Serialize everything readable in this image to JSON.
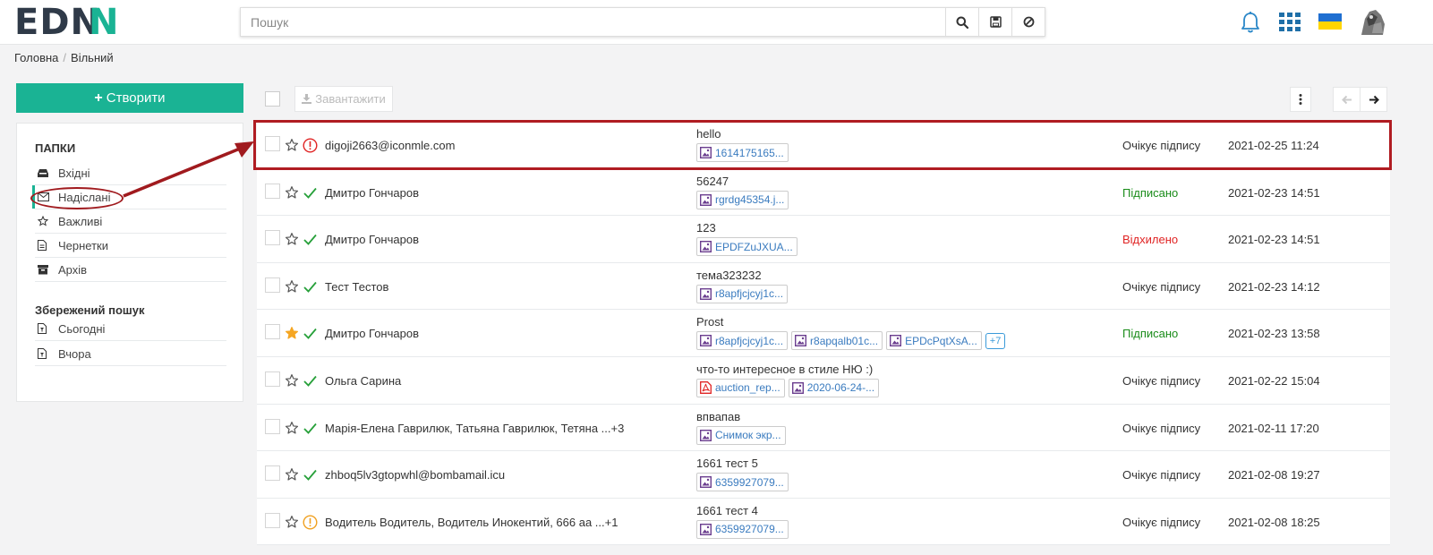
{
  "header": {
    "logo": {
      "ed": "ED",
      "n1": "N",
      "n2": "N",
      "i": "I"
    },
    "search_placeholder": "Пошук"
  },
  "breadcrumb": {
    "home": "Головна",
    "current": "Вільний"
  },
  "sidebar": {
    "create_label": "Створити",
    "folders_heading": "ПАПКИ",
    "folders": [
      {
        "label": "Вхідні",
        "icon": "inbox-icon"
      },
      {
        "label": "Надіслані",
        "icon": "envelope-icon"
      },
      {
        "label": "Важливі",
        "icon": "star-icon"
      },
      {
        "label": "Чернетки",
        "icon": "file-icon"
      },
      {
        "label": "Архів",
        "icon": "archive-icon"
      }
    ],
    "saved_heading": "Збережений пошук",
    "saved": [
      {
        "label": "Сьогодні",
        "icon": "file-filter-icon"
      },
      {
        "label": "Вчора",
        "icon": "file-filter-icon"
      }
    ]
  },
  "toolbar": {
    "download_label": "Завантажити"
  },
  "colors": {
    "accent": "#1ab394",
    "signed": "#1a8c1a",
    "rejected": "#e02424",
    "highlight": "#b01c22"
  },
  "messages": [
    {
      "sender": "digoji2663@iconmle.com",
      "subject": "hello",
      "starred": false,
      "state": "error",
      "attachments": [
        {
          "name": "1614175165...",
          "type": "image"
        }
      ],
      "more": "",
      "status": "Очікує підпису",
      "status_kind": "pending",
      "date": "2021-02-25 11:24"
    },
    {
      "sender": "Дмитро Гончаров",
      "subject": "56247",
      "starred": false,
      "state": "ok",
      "attachments": [
        {
          "name": "rgrdg45354.j...",
          "type": "image"
        }
      ],
      "more": "",
      "status": "Підписано",
      "status_kind": "signed",
      "date": "2021-02-23 14:51"
    },
    {
      "sender": "Дмитро Гончаров",
      "subject": "123",
      "starred": false,
      "state": "ok",
      "attachments": [
        {
          "name": "EPDFZuJXUA...",
          "type": "image"
        }
      ],
      "more": "",
      "status": "Відхилено",
      "status_kind": "rejected",
      "date": "2021-02-23 14:51"
    },
    {
      "sender": "Тест Тестов",
      "subject": "тема323232",
      "starred": false,
      "state": "ok",
      "attachments": [
        {
          "name": "r8apfjcjcyj1c...",
          "type": "image"
        }
      ],
      "more": "",
      "status": "Очікує підпису",
      "status_kind": "pending",
      "date": "2021-02-23 14:12"
    },
    {
      "sender": "Дмитро Гончаров",
      "subject": "Prost",
      "starred": true,
      "state": "ok",
      "attachments": [
        {
          "name": "r8apfjcjcyj1c...",
          "type": "image"
        },
        {
          "name": "r8apqalb01c...",
          "type": "image"
        },
        {
          "name": "EPDcPqtXsA...",
          "type": "image"
        }
      ],
      "more": "+7",
      "status": "Підписано",
      "status_kind": "signed",
      "date": "2021-02-23 13:58"
    },
    {
      "sender": "Ольга Сарина",
      "subject": "что-то интересное в стиле НЮ :)",
      "starred": false,
      "state": "ok",
      "attachments": [
        {
          "name": "auction_rep...",
          "type": "pdf"
        },
        {
          "name": "2020-06-24-...",
          "type": "image"
        }
      ],
      "more": "",
      "status": "Очікує підпису",
      "status_kind": "pending",
      "date": "2021-02-22 15:04"
    },
    {
      "sender": "Марія-Елена Гаврилюк, Татьяна Гаврилюк, Тетяна ...+3",
      "subject": "впвапав",
      "starred": false,
      "state": "ok",
      "attachments": [
        {
          "name": "Снимок экр...",
          "type": "image"
        }
      ],
      "more": "",
      "status": "Очікує підпису",
      "status_kind": "pending",
      "date": "2021-02-11 17:20"
    },
    {
      "sender": "zhboq5lv3gtopwhl@bombamail.icu",
      "subject": "1661 тест 5",
      "starred": false,
      "state": "ok",
      "attachments": [
        {
          "name": "6359927079...",
          "type": "image"
        }
      ],
      "more": "",
      "status": "Очікує підпису",
      "status_kind": "pending",
      "date": "2021-02-08 19:27"
    },
    {
      "sender": "Водитель Водитель, Водитель Инокентий, 666 аа ...+1",
      "subject": "1661 тест 4",
      "starred": false,
      "state": "warning",
      "attachments": [
        {
          "name": "6359927079...",
          "type": "image"
        }
      ],
      "more": "",
      "status": "Очікує підпису",
      "status_kind": "pending",
      "date": "2021-02-08 18:25"
    }
  ]
}
